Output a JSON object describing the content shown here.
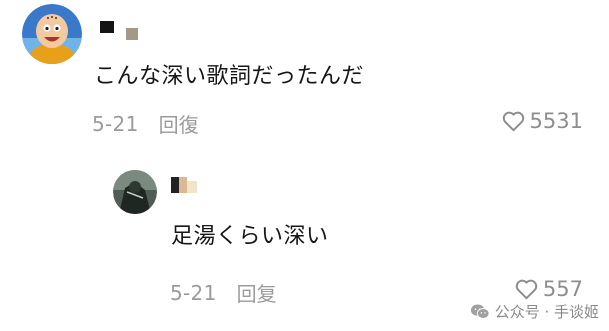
{
  "comment": {
    "text": "こんな深い歌詞だったんだ",
    "date": "5-21",
    "reply_label": "回復",
    "likes": "5531"
  },
  "reply": {
    "text": "足湯くらい深い",
    "date": "5-21",
    "reply_label": "回复",
    "likes": "557"
  },
  "watermark": {
    "text": "公众号 · 手谈姬"
  },
  "icons": {
    "like": "heart-outline-icon",
    "watermark": "wechat-icon"
  },
  "colors": {
    "text": "#161616",
    "meta": "#9b9b9b",
    "background": "#ffffff"
  }
}
